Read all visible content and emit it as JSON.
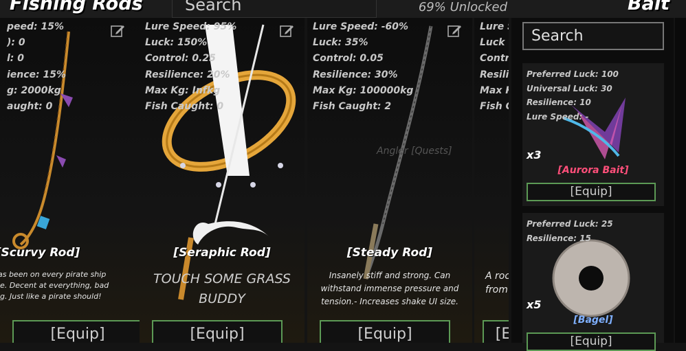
{
  "header": {
    "title": "Fishing Rods",
    "search_placeholder": "Search",
    "unlocked": "69% Unlocked",
    "bait_title": "Bait"
  },
  "rods": [
    {
      "stats": [
        "peed: 15%",
        "): 0",
        "l: 0",
        "ience: 15%",
        "g: 2000kg",
        "aught: 0"
      ],
      "name": "[Scurvy Rod]",
      "description": [
        "has been on every pirate ship",
        "ble. Decent at everything, bad",
        "ing. Just like a pirate should!"
      ],
      "equip": "[Equip]"
    },
    {
      "stats": [
        "Lure Speed: 95%",
        "Luck: 150%",
        "Control: 0.25",
        "Resilience: 20%",
        "Max Kg: Infkg",
        "Fish Caught: 0"
      ],
      "name": "[Seraphic Rod]",
      "description": [
        "TOUCH SOME GRASS",
        "BUDDY"
      ],
      "equip": "[Equip]"
    },
    {
      "stats": [
        "Lure Speed: -60%",
        "Luck: 35%",
        "Control: 0.05",
        "Resilience: 30%",
        "Max Kg: 100000kg",
        "Fish Caught: 2"
      ],
      "name": "[Steady Rod]",
      "description": [
        "Insanely stiff and strong. Can",
        "withstand immense pressure and",
        "tension.- Increases shake UI size."
      ],
      "equip": "[Equip]"
    },
    {
      "stats": [
        "Lure S",
        "Luck",
        "Contr",
        "Resili",
        "Max K",
        "Fish C"
      ],
      "name": "",
      "description": [
        "A roc",
        "from"
      ],
      "equip": "[E"
    }
  ],
  "world_label": "Angler [Quests]",
  "bait": {
    "search_placeholder": "Search",
    "items": [
      {
        "stats": [
          "Preferred Luck: 100",
          "Universal Luck: 30",
          "Resilience: 10",
          "Lure Speed: -"
        ],
        "quantity": "x3",
        "name": "[Aurora Bait]",
        "name_color": "#ff4f7a",
        "equip": "[Equip]",
        "icon": "aurora-bait-icon"
      },
      {
        "stats": [
          "Preferred Luck: 25",
          "Resilience: 15"
        ],
        "quantity": "x5",
        "name": "[Bagel]",
        "name_color": "#7fb0ff",
        "equip": "[Equip]",
        "icon": "bagel-icon"
      }
    ]
  }
}
